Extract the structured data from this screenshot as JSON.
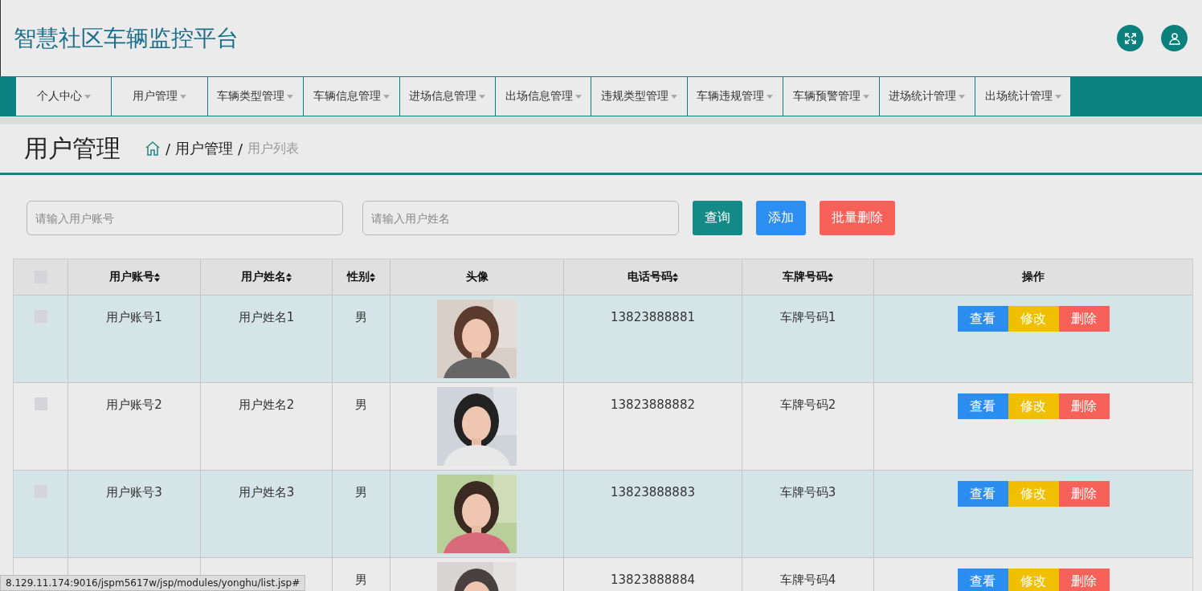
{
  "app_title": "智慧社区车辆监控平台",
  "nav": [
    {
      "label": "个人中心"
    },
    {
      "label": "用户管理"
    },
    {
      "label": "车辆类型管理"
    },
    {
      "label": "车辆信息管理"
    },
    {
      "label": "进场信息管理"
    },
    {
      "label": "出场信息管理"
    },
    {
      "label": "违规类型管理"
    },
    {
      "label": "车辆违规管理"
    },
    {
      "label": "车辆预警管理"
    },
    {
      "label": "进场统计管理"
    },
    {
      "label": "出场统计管理"
    }
  ],
  "page_title": "用户管理",
  "breadcrumb": [
    {
      "separator": "/",
      "label": "用户管理"
    },
    {
      "separator": "/",
      "label": "用户列表"
    }
  ],
  "search": {
    "fields": [
      {
        "placeholder": "请输入用户账号"
      },
      {
        "placeholder": "请输入用户姓名"
      }
    ],
    "buttons": [
      {
        "label": "查询",
        "kind": "search"
      },
      {
        "label": "添加",
        "kind": "add"
      },
      {
        "label": "批量删除",
        "kind": "delete"
      }
    ]
  },
  "table": {
    "select_all_checked": false,
    "columns": [
      {
        "label": "用户账号",
        "sortable": true
      },
      {
        "label": "用户姓名",
        "sortable": true
      },
      {
        "label": "性别",
        "sortable": true
      },
      {
        "label": "头像",
        "sortable": false
      },
      {
        "label": "电话号码",
        "sortable": true
      },
      {
        "label": "车牌号码",
        "sortable": true
      },
      {
        "label": "操作",
        "sortable": false
      }
    ],
    "rows": [
      {
        "checked": false,
        "highlighted": true,
        "account": "用户账号1",
        "name": "用户姓名1",
        "gender": "男",
        "phone": "13823888881",
        "plate": "车牌号码1",
        "actions": [
          {
            "label": "查看",
            "kind": "view"
          },
          {
            "label": "修改",
            "kind": "edit"
          },
          {
            "label": "删除",
            "kind": "delete"
          }
        ]
      },
      {
        "checked": false,
        "highlighted": false,
        "account": "用户账号2",
        "name": "用户姓名2",
        "gender": "男",
        "phone": "13823888882",
        "plate": "车牌号码2",
        "actions": [
          {
            "label": "查看",
            "kind": "view"
          },
          {
            "label": "修改",
            "kind": "edit"
          },
          {
            "label": "删除",
            "kind": "delete"
          }
        ]
      },
      {
        "checked": false,
        "highlighted": true,
        "account": "用户账号3",
        "name": "用户姓名3",
        "gender": "男",
        "phone": "13823888883",
        "plate": "车牌号码3",
        "actions": [
          {
            "label": "查看",
            "kind": "view"
          },
          {
            "label": "修改",
            "kind": "edit"
          },
          {
            "label": "删除",
            "kind": "delete"
          }
        ]
      },
      {
        "highlighted": false,
        "gender": "男",
        "phone": "13823888884",
        "plate": "车牌号码4",
        "actions": [
          {
            "label": "查看",
            "kind": "view"
          },
          {
            "label": "修改",
            "kind": "edit"
          },
          {
            "label": "删除",
            "kind": "delete"
          }
        ]
      }
    ]
  },
  "status_url": "8.129.11.174:9016/jspm5617w/jsp/modules/yonghu/list.jsp#"
}
